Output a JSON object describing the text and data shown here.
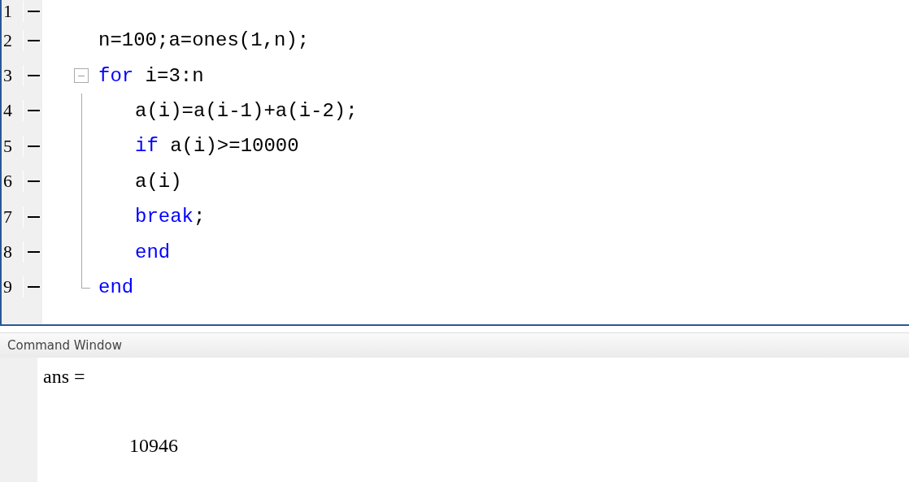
{
  "editor": {
    "lines": [
      {
        "number": "1"
      },
      {
        "number": "2",
        "tokens": [
          {
            "kind": "plain",
            "text": "n=100;a=ones(1,n);"
          }
        ]
      },
      {
        "number": "3",
        "tokens": [
          {
            "kind": "keyword",
            "text": "for"
          },
          {
            "kind": "plain",
            "text": " i=3:n"
          }
        ],
        "children": [
          {
            "number": "4",
            "tokens": [
              {
                "kind": "plain",
                "text": "a(i)=a(i-1)+a(i-2);"
              }
            ]
          },
          {
            "number": "5",
            "tokens": [
              {
                "kind": "keyword",
                "text": "if"
              },
              {
                "kind": "plain",
                "text": " a(i)>=10000"
              }
            ]
          },
          {
            "number": "6",
            "tokens": [
              {
                "kind": "plain",
                "text": "a(i)"
              }
            ]
          },
          {
            "number": "7",
            "tokens": [
              {
                "kind": "keyword",
                "text": "break"
              },
              {
                "kind": "plain",
                "text": ";"
              }
            ]
          },
          {
            "number": "8",
            "tokens": [
              {
                "kind": "keyword",
                "text": "end"
              }
            ]
          },
          {
            "number": "9",
            "tokens": [
              {
                "kind": "keyword",
                "text": "end"
              }
            ]
          }
        ]
      }
    ]
  },
  "command_window": {
    "title": "Command Window",
    "output": [
      {
        "kind": "label",
        "text": "ans ="
      },
      {
        "kind": "value",
        "text": "10946"
      }
    ]
  }
}
